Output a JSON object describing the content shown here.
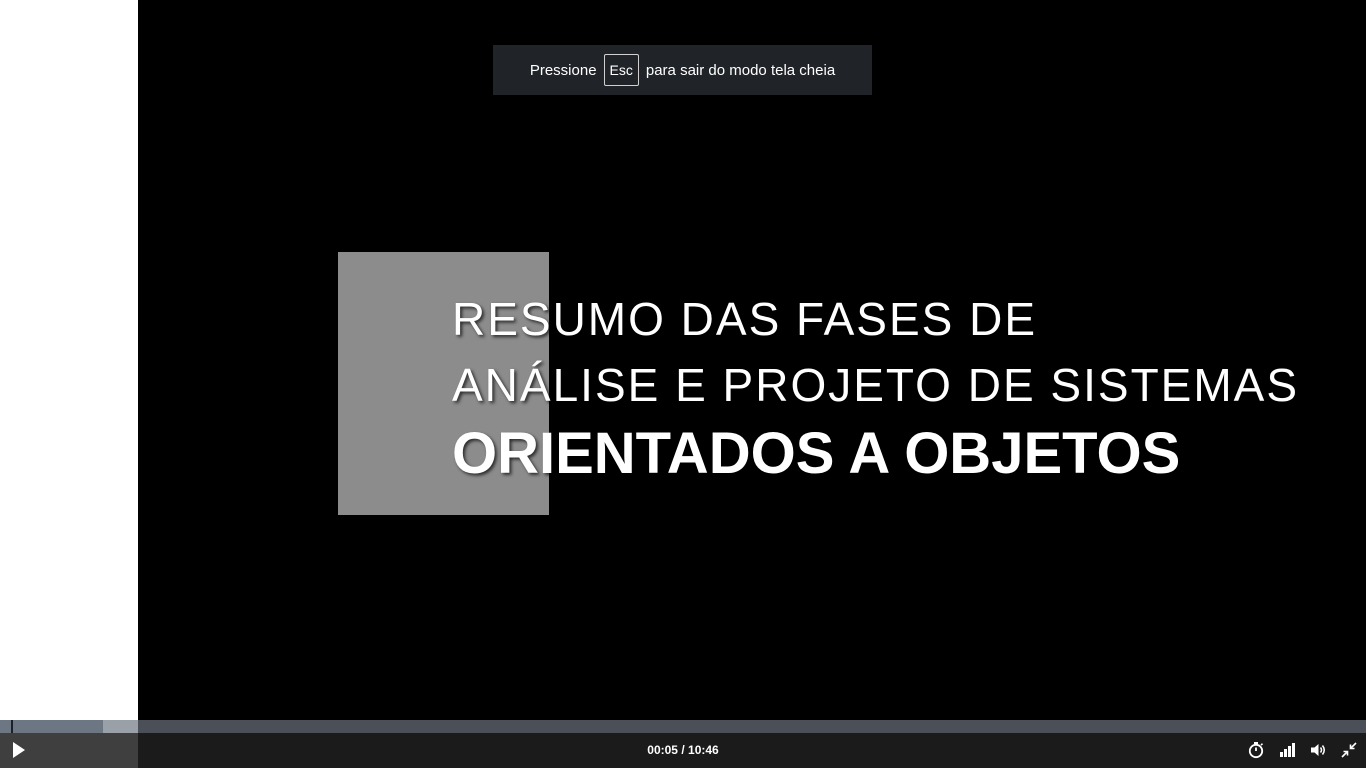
{
  "fullscreen_notice": {
    "prefix": "Pressione",
    "key": "Esc",
    "suffix": "para sair do modo tela cheia"
  },
  "slide": {
    "line1": "RESUMO DAS FASES DE",
    "line2": "ANÁLISE E PROJETO DE SISTEMAS",
    "line3": "ORIENTADOS A OBJETOS"
  },
  "player": {
    "current_time": "00:05",
    "separator": "/",
    "duration": "10:46",
    "played_fraction": 0.0077,
    "buffered_fraction": 0.101,
    "icons": [
      "play-icon",
      "timer-icon",
      "signal-quality-icon",
      "volume-icon",
      "exit-fullscreen-icon"
    ]
  },
  "colors": {
    "control_bar": "#1c1b1b",
    "progress_track": "#4b5058",
    "progress_buffered": "#9aa0a8",
    "progress_played": "#6c7783"
  }
}
